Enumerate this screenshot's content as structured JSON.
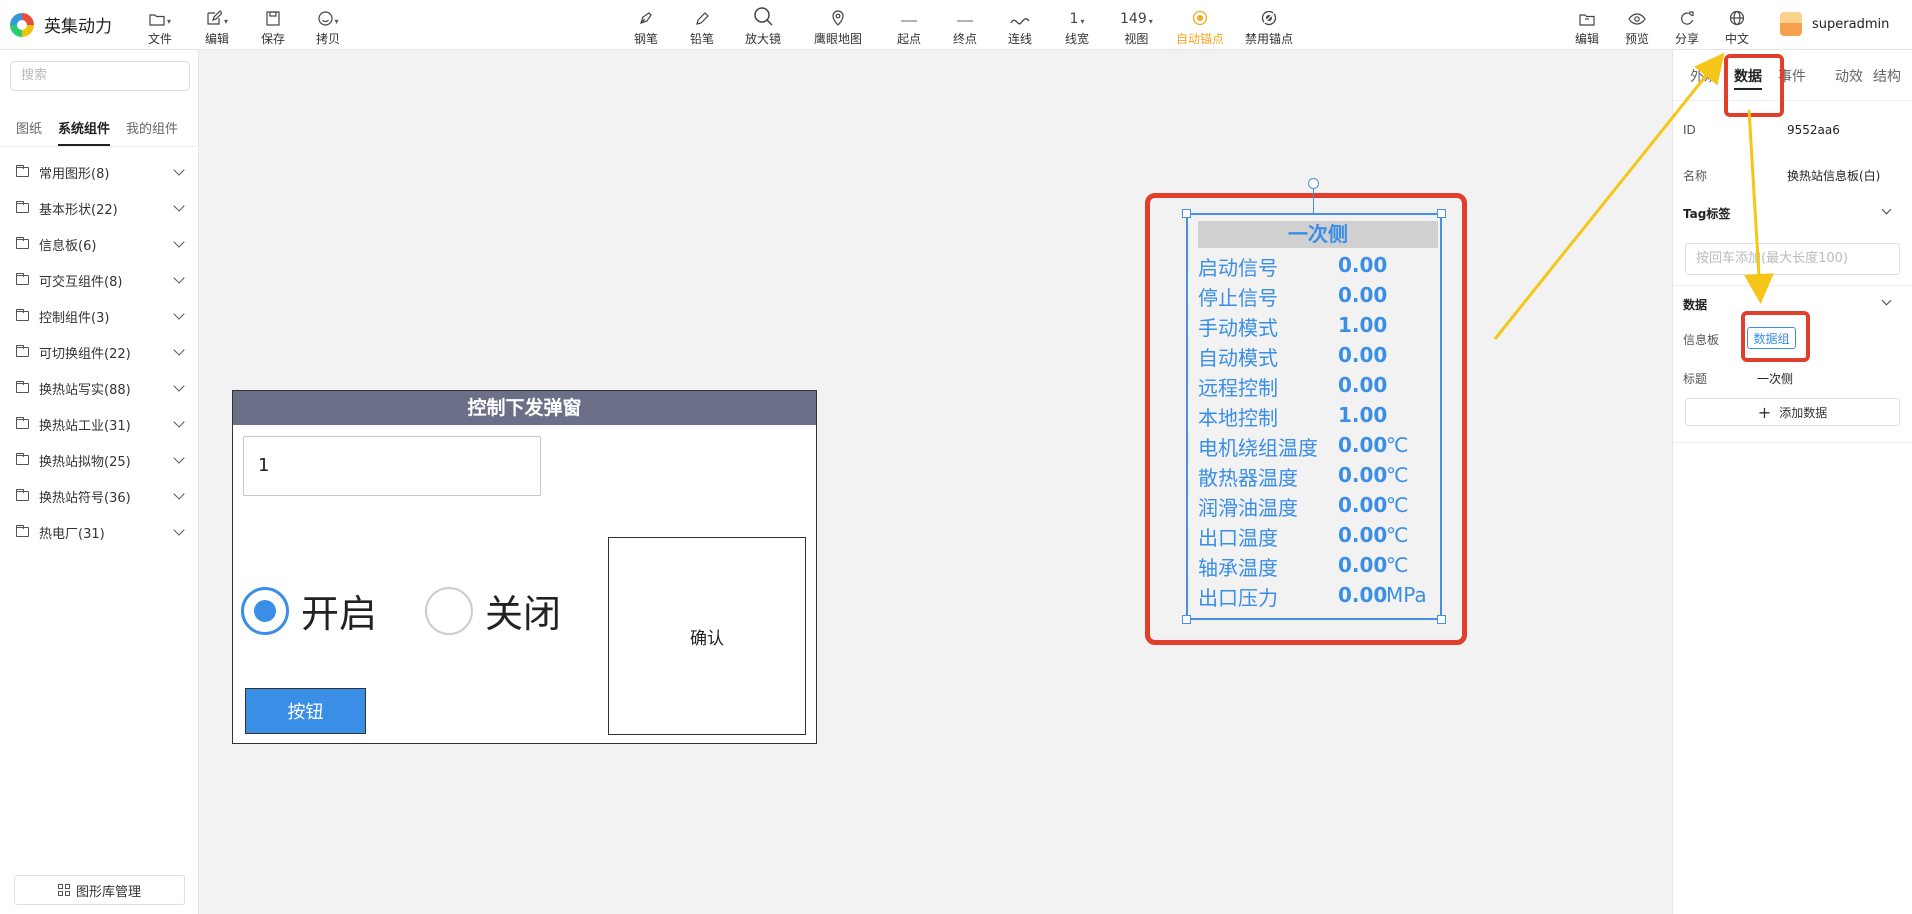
{
  "app": {
    "name": "英集动力"
  },
  "toolbar": {
    "left": [
      {
        "label": "文件",
        "icon": "file-icon"
      },
      {
        "label": "编辑",
        "icon": "edit-icon"
      },
      {
        "label": "保存",
        "icon": "save-icon"
      },
      {
        "label": "拷贝",
        "icon": "smile-icon"
      }
    ],
    "center": [
      {
        "label": "钢笔",
        "icon": "pen-icon"
      },
      {
        "label": "铅笔",
        "icon": "pencil-icon"
      },
      {
        "label": "放大镜",
        "icon": "magnifier-icon"
      },
      {
        "label": "鹰眼地图",
        "icon": "map-pin-icon"
      },
      {
        "label": "起点",
        "icon": "line-start-icon"
      },
      {
        "label": "终点",
        "icon": "line-end-icon"
      },
      {
        "label": "连线",
        "icon": "curve-icon"
      },
      {
        "label": "线宽",
        "value": "1"
      },
      {
        "label": "视图",
        "value": "149"
      },
      {
        "label": "自动锚点",
        "icon": "anchor-icon",
        "active": true
      },
      {
        "label": "禁用锚点",
        "icon": "anchor-off-icon"
      }
    ],
    "right": [
      {
        "label": "编辑",
        "icon": "edit-folder-icon"
      },
      {
        "label": "预览",
        "icon": "eye-icon"
      },
      {
        "label": "分享",
        "icon": "share-icon"
      },
      {
        "label": "中文",
        "icon": "globe-icon"
      }
    ],
    "user": "superadmin"
  },
  "sidebar": {
    "search_placeholder": "搜索",
    "tabs": [
      "图纸",
      "系统组件",
      "我的组件"
    ],
    "categories": [
      "常用图形(8)",
      "基本形状(22)",
      "信息板(6)",
      "可交互组件(8)",
      "控制组件(3)",
      "可切换组件(22)",
      "换热站写实(88)",
      "换热站工业(31)",
      "换热站拟物(25)",
      "换热站符号(36)",
      "热电厂(31)"
    ],
    "library_button": "图形库管理"
  },
  "popup": {
    "title": "控制下发弹窗",
    "input_value": "1",
    "radio_on": "开启",
    "radio_off": "关闭",
    "confirm": "确认",
    "button": "按钮"
  },
  "board": {
    "title": "一次侧",
    "rows": [
      {
        "label": "启动信号",
        "value": "0.00",
        "unit": ""
      },
      {
        "label": "停止信号",
        "value": "0.00",
        "unit": ""
      },
      {
        "label": "手动模式",
        "value": "1.00",
        "unit": ""
      },
      {
        "label": "自动模式",
        "value": "0.00",
        "unit": ""
      },
      {
        "label": "远程控制",
        "value": "0.00",
        "unit": ""
      },
      {
        "label": "本地控制",
        "value": "1.00",
        "unit": ""
      },
      {
        "label": "电机绕组温度",
        "value": "0.00",
        "unit": "℃"
      },
      {
        "label": "散热器温度",
        "value": "0.00",
        "unit": "℃"
      },
      {
        "label": "润滑油温度",
        "value": "0.00",
        "unit": "℃"
      },
      {
        "label": "出口温度",
        "value": "0.00",
        "unit": "℃"
      },
      {
        "label": "轴承温度",
        "value": "0.00",
        "unit": "℃"
      },
      {
        "label": "出口压力",
        "value": "0.00",
        "unit": "MPa"
      }
    ]
  },
  "rpanel": {
    "tabs": [
      "外观",
      "数据",
      "事件",
      "动效",
      "结构"
    ],
    "id_label": "ID",
    "id_value": "9552aa6",
    "name_label": "名称",
    "name_value": "换热站信息板(白)",
    "tag_label": "Tag标签",
    "tag_placeholder": "按回车添加(最大长度100)",
    "data_label": "数据",
    "board_label": "信息板",
    "data_group": "数据组",
    "title_label": "标题",
    "title_value": "一次侧",
    "add_data": "添加数据"
  },
  "colors": {
    "accent": "#3a8ee6",
    "highlight": "#e0402b",
    "arrow": "#f5c518",
    "active_tool": "#f5a623",
    "popup_title_bg": "#6b7088"
  }
}
